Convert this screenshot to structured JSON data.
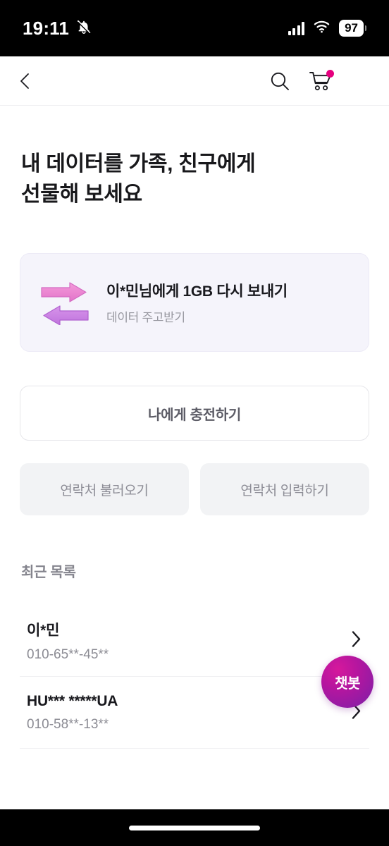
{
  "statusbar": {
    "time": "19:11",
    "bell_icon": "bell-muted-icon",
    "signal_icon": "cellular-signal-icon",
    "wifi_icon": "wifi-icon",
    "battery_level": "97"
  },
  "header": {
    "back_icon": "back-chevron-icon",
    "search_icon": "search-icon",
    "cart_icon": "shopping-cart-icon",
    "cart_badge_color": "#e6007e",
    "menu_icon": "hamburger-menu-icon"
  },
  "main": {
    "title_line1": "내 데이터를 가족, 친구에게",
    "title_line2": "선물해 보세요",
    "resend_card": {
      "icon": "data-exchange-arrows-icon",
      "title": "이*민님에게 1GB 다시 보내기",
      "subtitle": "데이터 주고받기",
      "bg_color": "#f5f4fb",
      "arrow_color_top": "#ef7fd0",
      "arrow_color_bottom": "#c97fe0"
    },
    "primary_button": "나에게 충전하기",
    "secondary_buttons": [
      "연락처 불러오기",
      "연락처 입력하기"
    ],
    "recent_section_title": "최근 목록",
    "recent_items": [
      {
        "name": "이*민",
        "phone": "010-65**-45**",
        "chevron": "chevron-right-icon"
      },
      {
        "name": "HU*** *****UA",
        "phone": "010-58**-13**",
        "chevron": "chevron-right-icon"
      }
    ]
  },
  "chatbot": {
    "label": "챗봇"
  }
}
